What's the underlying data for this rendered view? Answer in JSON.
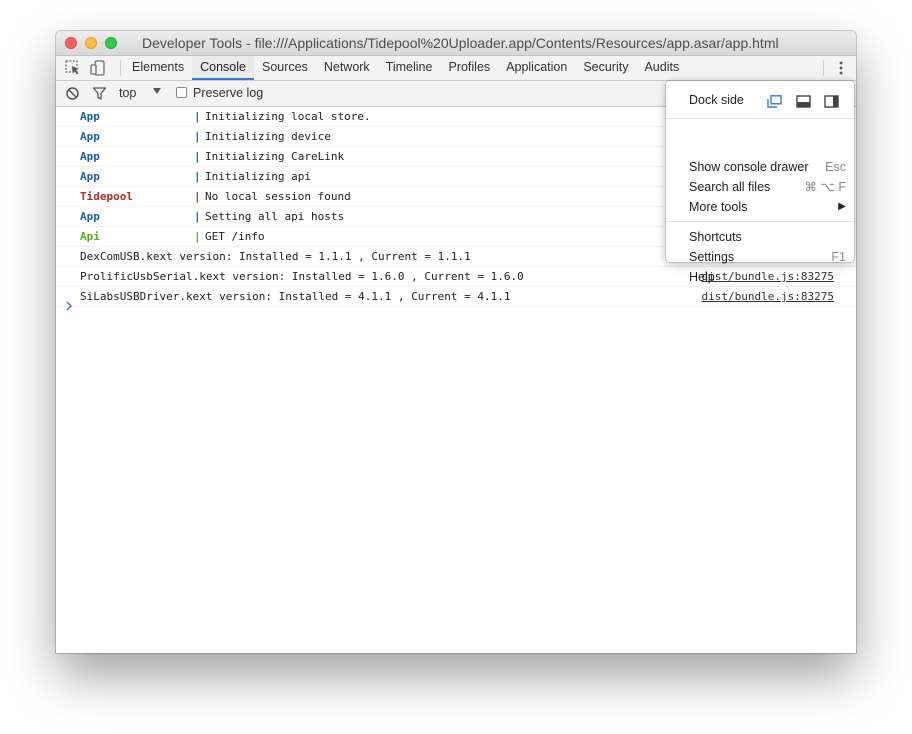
{
  "window": {
    "title": "Developer Tools - file:///Applications/Tidepool%20Uploader.app/Contents/Resources/app.asar/app.html"
  },
  "tabs": [
    {
      "label": "Elements"
    },
    {
      "label": "Console",
      "active": true
    },
    {
      "label": "Sources"
    },
    {
      "label": "Network"
    },
    {
      "label": "Timeline"
    },
    {
      "label": "Profiles"
    },
    {
      "label": "Application"
    },
    {
      "label": "Security"
    },
    {
      "label": "Audits"
    }
  ],
  "toolbar": {
    "context": "top",
    "preserve_log_label": "Preserve log",
    "preserve_log_checked": false
  },
  "console": {
    "rows": [
      {
        "source": "App",
        "color": "#1a5fb4",
        "message": "Initializing local store."
      },
      {
        "source": "App",
        "color": "#1a5fb4",
        "message": "Initializing device"
      },
      {
        "source": "App",
        "color": "#1a5fb4",
        "message": "Initializing CareLink"
      },
      {
        "source": "App",
        "color": "#1a5fb4",
        "message": "Initializing api"
      },
      {
        "source": "Tidepool",
        "color": "#b32a2a",
        "message": "No local session found"
      },
      {
        "source": "App",
        "color": "#1a5fb4",
        "message": "Setting all api hosts"
      },
      {
        "source": "Api",
        "color": "#52b31d",
        "message": "GET /info"
      }
    ],
    "plain_rows": [
      {
        "message": "DexComUSB.kext version: Installed = 1.1.1 , Current = 1.1.1",
        "link": ""
      },
      {
        "message": "ProlificUsbSerial.kext version: Installed = 1.6.0 , Current = 1.6.0",
        "link": "dist/bundle.js:83275"
      },
      {
        "message": "SiLabsUSBDriver.kext version: Installed = 4.1.1 , Current = 4.1.1",
        "link": "dist/bundle.js:83275"
      }
    ]
  },
  "menu": {
    "dock_side_label": "Dock side",
    "show_console_drawer": {
      "label": "Show console drawer",
      "shortcut": "Esc"
    },
    "search_all_files": {
      "label": "Search all files",
      "shortcut": "⌘ ⌥ F"
    },
    "more_tools": {
      "label": "More tools",
      "shortcut": "▶"
    },
    "shortcuts": {
      "label": "Shortcuts"
    },
    "settings": {
      "label": "Settings",
      "shortcut": "F1"
    },
    "help": {
      "label": "Help"
    }
  }
}
